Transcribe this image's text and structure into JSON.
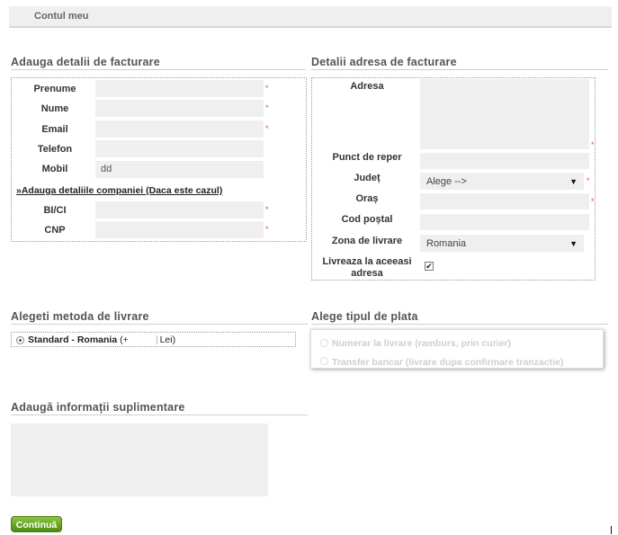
{
  "header": {
    "title": "Contul meu"
  },
  "billing": {
    "title": "Adauga detalii de facturare",
    "fields": {
      "prenume": {
        "label": "Prenume",
        "value": ""
      },
      "nume": {
        "label": "Nume",
        "value": ""
      },
      "email": {
        "label": "Email",
        "value": ""
      },
      "telefon": {
        "label": "Telefon",
        "value": ""
      },
      "mobil": {
        "label": "Mobil",
        "value": "dd"
      },
      "bici": {
        "label": "BI/CI",
        "value": ""
      },
      "cnp": {
        "label": "CNP",
        "value": ""
      }
    },
    "company_link": "»Adauga detaliile companiei (Daca este cazul)",
    "required_mark": "*"
  },
  "address": {
    "title": "Detalii adresa de facturare",
    "adresa_label": "Adresa",
    "punct_label": "Punct de reper",
    "judet_label": "Județ",
    "judet_value": "Alege -->",
    "oras_label": "Oraș",
    "cod_label": "Cod poștal",
    "zona_label": "Zona de livrare",
    "zona_value": "Romania",
    "same_label": "Livreaza la aceeasi adresa",
    "same_checked": true
  },
  "shipping": {
    "title": "Alegeti metoda de livrare",
    "option_name": "Standard - Romania",
    "option_price_left": "(+",
    "option_price_right": "Lei)"
  },
  "payment": {
    "title": "Alege tipul de plata",
    "options": [
      "Numerar la livrare (ramburs, prin curier)",
      "Transfer bancar (livrare dupa confirmare tranzactie)"
    ]
  },
  "extra": {
    "title": "Adaugă informații suplimentare",
    "value": ""
  },
  "actions": {
    "continue_label": "Continuă"
  },
  "colors": {
    "accent_green": "#6aa82a",
    "required": "#e24f6e",
    "field_bg": "#efefef"
  }
}
